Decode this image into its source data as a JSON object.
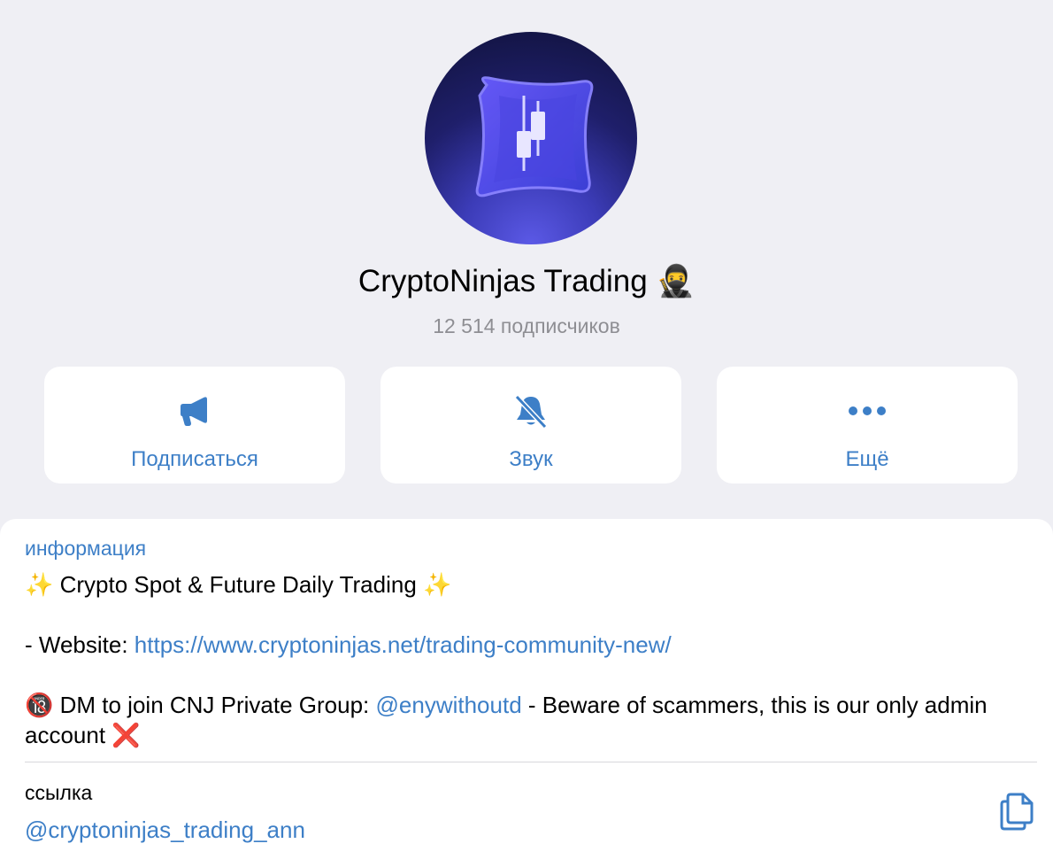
{
  "profile": {
    "title": "CryptoNinjas Trading",
    "title_emoji": "🥷",
    "subscribers": "12 514 подписчиков"
  },
  "actions": [
    {
      "label": "Подписаться",
      "icon": "megaphone-icon"
    },
    {
      "label": "Звук",
      "icon": "bell-slash-icon"
    },
    {
      "label": "Ещё",
      "icon": "ellipsis-icon"
    }
  ],
  "info": {
    "heading": "информация",
    "line1_emoji": "✨",
    "line1_text": "Crypto Spot & Future Daily Trading",
    "website_prefix": "- Website: ",
    "website_url": "https://www.cryptoninjas.net/trading-community-new/",
    "line3_emoji": "🔞",
    "line3_text": "DM to join CNJ Private Group: ",
    "handle": "@enywithoutd",
    "line3_suffix": " - Beware of scammers, this is our only admin account",
    "line3_end_emoji": "❌"
  },
  "link": {
    "heading": "ссылка",
    "value": "@cryptoninjas_trading_ann",
    "copy_icon": "copy-icon"
  },
  "colors": {
    "accent": "#3d7fc7",
    "background": "#efeff4",
    "secondary_text": "#8e8e93"
  }
}
